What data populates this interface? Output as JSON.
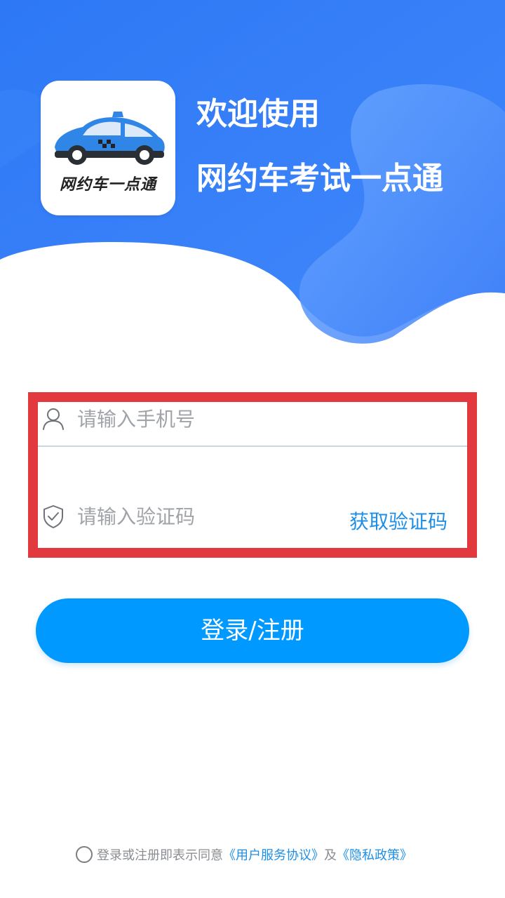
{
  "header": {
    "welcome_line1": "欢迎使用",
    "welcome_line2": "网约车考试一点通",
    "logo_text": "网约车一点通",
    "colors": {
      "gradient_start": "#2f7bf6",
      "gradient_end": "#4a8dfb",
      "wave_light": "#5fa2ff"
    }
  },
  "form": {
    "phone_placeholder": "请输入手机号",
    "phone_icon": "user-icon",
    "code_placeholder": "请输入验证码",
    "code_icon": "shield-check-icon",
    "get_code_label": "获取验证码",
    "highlight_color": "#e2393f"
  },
  "login_button": {
    "label": "登录/注册",
    "color": "#0099ff"
  },
  "agreement": {
    "prefix": "登录或注册即表示同意",
    "user_agreement": "《用户服务协议》",
    "conjunction": "及",
    "privacy_policy": "《隐私政策》"
  }
}
